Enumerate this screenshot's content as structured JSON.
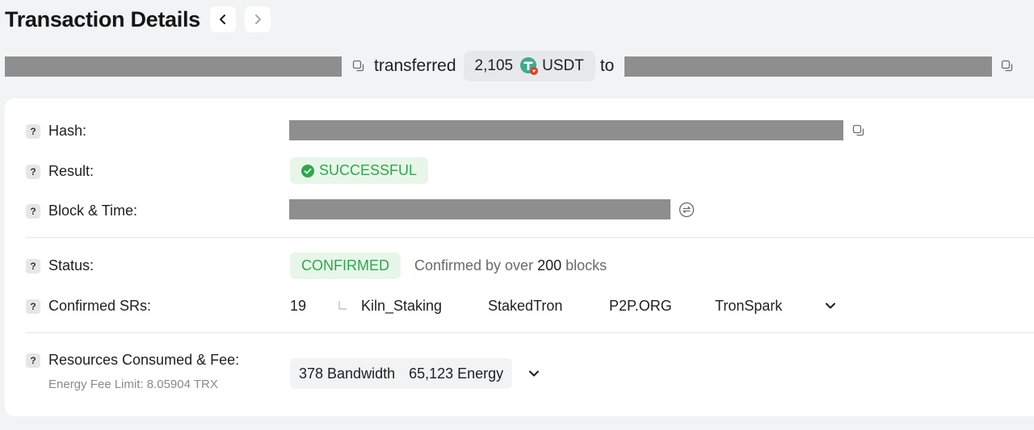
{
  "header": {
    "title": "Transaction Details"
  },
  "transfer": {
    "verb": "transferred",
    "amount": "2,105",
    "token": "USDT",
    "to_label": "to"
  },
  "details": {
    "hash_label": "Hash:",
    "result_label": "Result:",
    "result_value": "SUCCESSFUL",
    "block_time_label": "Block & Time:",
    "status_label": "Status:",
    "status_value": "CONFIRMED",
    "status_note_prefix": "Confirmed by over",
    "status_note_count": "200",
    "status_note_suffix": "blocks",
    "srs_label": "Confirmed SRs:",
    "srs_count": "19",
    "srs": [
      "Kiln_Staking",
      "StakedTron",
      "P2P.ORG",
      "TronSpark"
    ],
    "resources_label": "Resources Consumed & Fee:",
    "energy_fee_limit": "Energy Fee Limit: 8.05904 TRX",
    "bandwidth": "378 Bandwidth",
    "energy": "65,123 Energy"
  },
  "colors": {
    "success": "#2ea84a",
    "success_bg": "#e8f6ea",
    "redaction": "#8e8e8e"
  }
}
